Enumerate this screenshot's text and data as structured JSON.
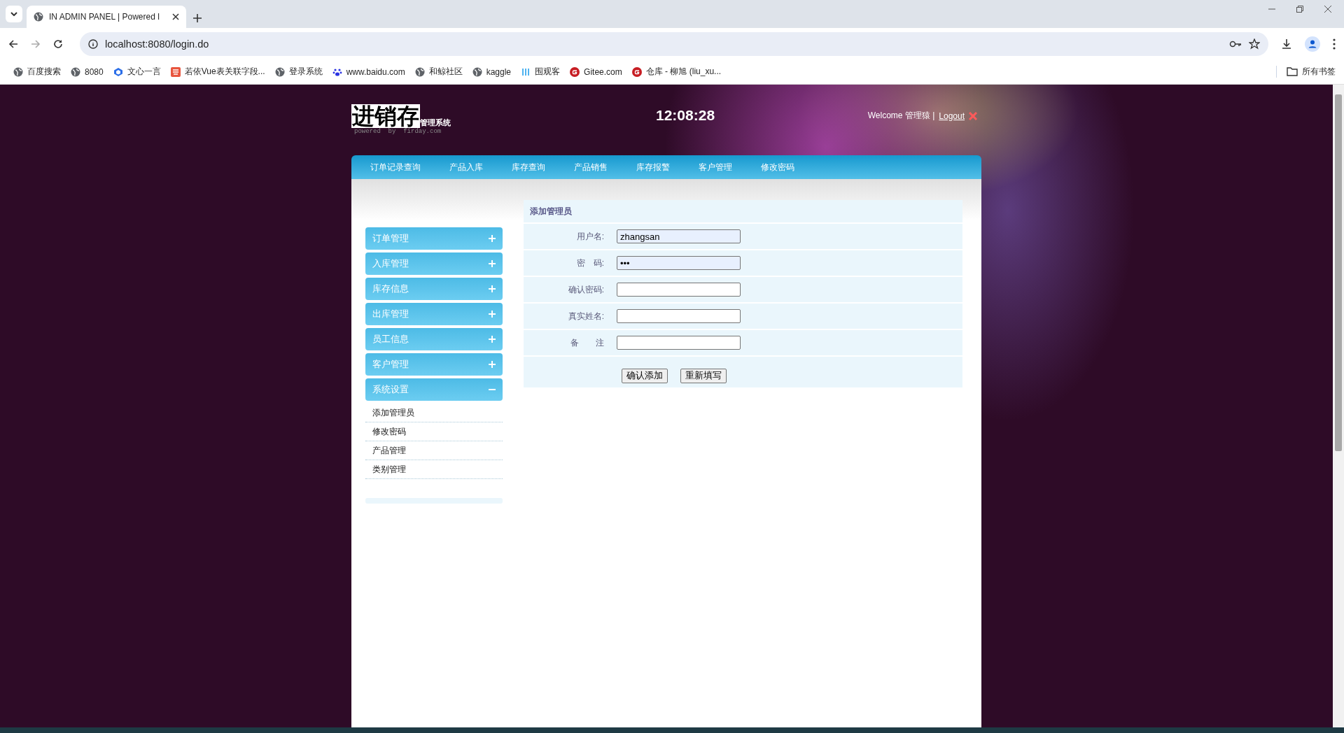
{
  "browser": {
    "tabs": [
      {
        "title": "IN ADMIN PANEL | Powered l",
        "selected": true
      }
    ],
    "address": "localhost:8080/login.do",
    "bookmarks": [
      {
        "label": "百度搜索",
        "kind": "globe"
      },
      {
        "label": "8080",
        "kind": "globe"
      },
      {
        "label": "文心一言",
        "kind": "cube"
      },
      {
        "label": "若依Vue表关联字段...",
        "kind": "square"
      },
      {
        "label": "登录系统",
        "kind": "globe"
      },
      {
        "label": "www.baidu.com",
        "kind": "paw"
      },
      {
        "label": "和鲸社区",
        "kind": "globe"
      },
      {
        "label": "kaggle",
        "kind": "globe"
      },
      {
        "label": "围观客",
        "kind": "bars"
      },
      {
        "label": "Gitee.com",
        "kind": "gitee"
      },
      {
        "label": "仓库 - 柳旭 (liu_xu...",
        "kind": "gitee"
      }
    ],
    "all_bookmarks": "所有书签"
  },
  "header": {
    "logo": "进销存",
    "logo_sub": "管理系统",
    "tagline": "powered  by  firday.com",
    "clock": "12:08:28",
    "welcome": "Welcome 管理猿 |",
    "logout": "Logout"
  },
  "nav": [
    "订单记录查询",
    "产品入库",
    "库存查询",
    "产品销售",
    "库存报警",
    "客户管理",
    "修改密码"
  ],
  "sidebar": [
    {
      "label": "订单管理",
      "expanded": false
    },
    {
      "label": "入库管理",
      "expanded": false
    },
    {
      "label": "库存信息",
      "expanded": false
    },
    {
      "label": "出库管理",
      "expanded": false
    },
    {
      "label": "员工信息",
      "expanded": false
    },
    {
      "label": "客户管理",
      "expanded": false
    },
    {
      "label": "系统设置",
      "expanded": true,
      "children": [
        "添加管理员",
        "修改密码",
        "产品管理",
        "类别管理"
      ]
    }
  ],
  "form": {
    "title": "添加管理员",
    "fields": [
      {
        "label": "用户名:",
        "value": "zhangsan",
        "autofilled": true
      },
      {
        "label": "密　码:",
        "value": "•••",
        "autofilled": true
      },
      {
        "label": "确认密码:",
        "autofilled": false
      },
      {
        "label": "真实姓名:",
        "autofilled": false
      },
      {
        "label": "备　　注",
        "autofilled": false
      }
    ],
    "buttons": [
      "确认添加",
      "重新填写"
    ]
  }
}
